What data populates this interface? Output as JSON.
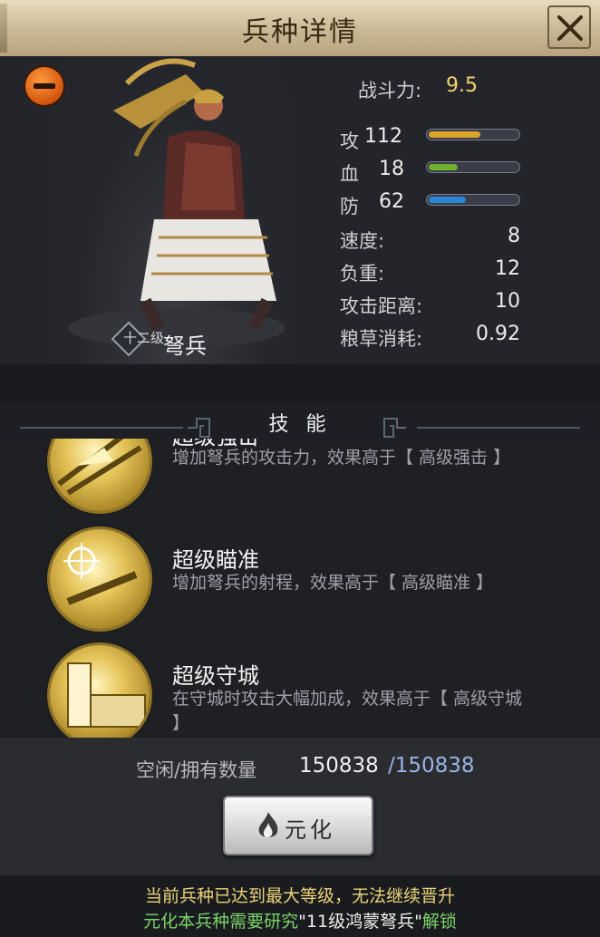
{
  "header": {
    "title": "兵种详情"
  },
  "unit": {
    "name": "弩兵",
    "level_badge": "十二级",
    "power_label": "战斗力:",
    "power_value": "9.5",
    "stats": [
      {
        "label": "攻",
        "value": "112",
        "fill": 0.58,
        "color": "#d9a528"
      },
      {
        "label": "血",
        "value": "18",
        "fill": 0.33,
        "color": "#6fb02e"
      },
      {
        "label": "防",
        "value": "62",
        "fill": 0.42,
        "color": "#2a86d6"
      }
    ],
    "attributes": [
      {
        "label": "速度:",
        "value": "8"
      },
      {
        "label": "负重:",
        "value": "12"
      },
      {
        "label": "攻击距离:",
        "value": "10"
      },
      {
        "label": "粮草消耗:",
        "value": "0.92"
      }
    ]
  },
  "skills": {
    "title": "技 能",
    "items": [
      {
        "name": "超级强击",
        "desc": "增加弩兵的攻击力，效果高于【 高级强击 】",
        "icon": "crossbow-strike-icon"
      },
      {
        "name": "超级瞄准",
        "desc": "增加弩兵的射程，效果高于【 高级瞄准 】",
        "icon": "crosshair-scope-icon"
      },
      {
        "name": "超级守城",
        "desc": "在守城时攻击大幅加成，效果高于【 高级守城 】",
        "icon": "castle-tower-icon"
      }
    ]
  },
  "troops": {
    "label": "空闲/拥有数量",
    "free": "150838",
    "total": "/150838"
  },
  "action": {
    "label": "元化"
  },
  "notice": {
    "line1": "当前兵种已达到最大等级，无法继续晋升",
    "line2_prefix": "元化本兵种需要研究",
    "line2_target": "\"11级鸿蒙弩兵\"",
    "line2_suffix": "解锁"
  },
  "colors": {
    "accent_gold": "#f1d36b",
    "accent_green": "#7cd36b",
    "accent_blue": "#9ab4e6"
  }
}
